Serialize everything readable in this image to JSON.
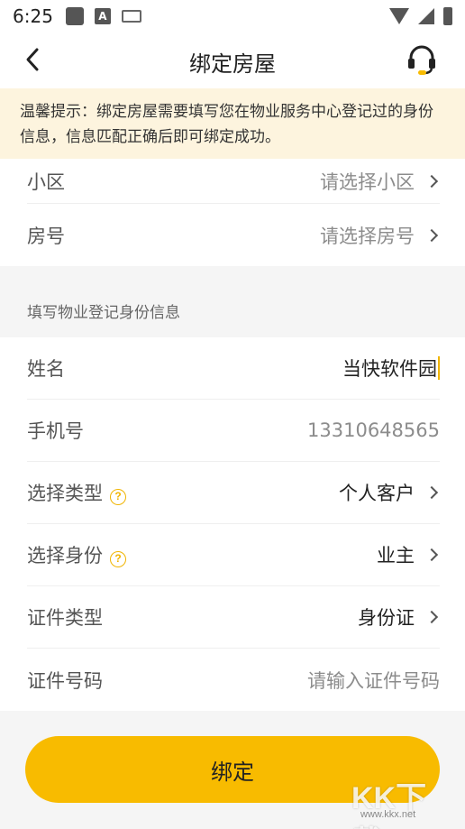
{
  "status_bar": {
    "time": "6:25",
    "icons": [
      "app-notification-icon",
      "a-notification-icon",
      "keyboard-icon",
      "wifi-icon",
      "signal-icon",
      "battery-icon"
    ]
  },
  "nav": {
    "title": "绑定房屋",
    "back_icon": "chevron-left-icon",
    "support_icon": "headset-icon"
  },
  "notice": {
    "text": "温馨提示：绑定房屋需要填写您在物业服务中心登记过的身份信息，信息匹配正确后即可绑定成功。"
  },
  "house": {
    "community_label": "小区",
    "community_placeholder": "请选择小区",
    "room_label": "房号",
    "room_placeholder": "请选择房号"
  },
  "section_title": "填写物业登记身份信息",
  "identity": {
    "name_label": "姓名",
    "name_value": "当快软件园",
    "phone_label": "手机号",
    "phone_value": "13310648565",
    "type_label": "选择类型",
    "type_value": "个人客户",
    "role_label": "选择身份",
    "role_value": "业主",
    "id_type_label": "证件类型",
    "id_type_value": "身份证",
    "id_number_label": "证件号码",
    "id_number_placeholder": "请输入证件号码",
    "help_glyph": "?"
  },
  "submit_label": "绑定",
  "watermark": {
    "big": "KK下载",
    "small": "www.kkx.net"
  },
  "colors": {
    "accent": "#f8bb00",
    "notice_bg": "#fdf4de",
    "page_bg": "#f5f5f5"
  }
}
